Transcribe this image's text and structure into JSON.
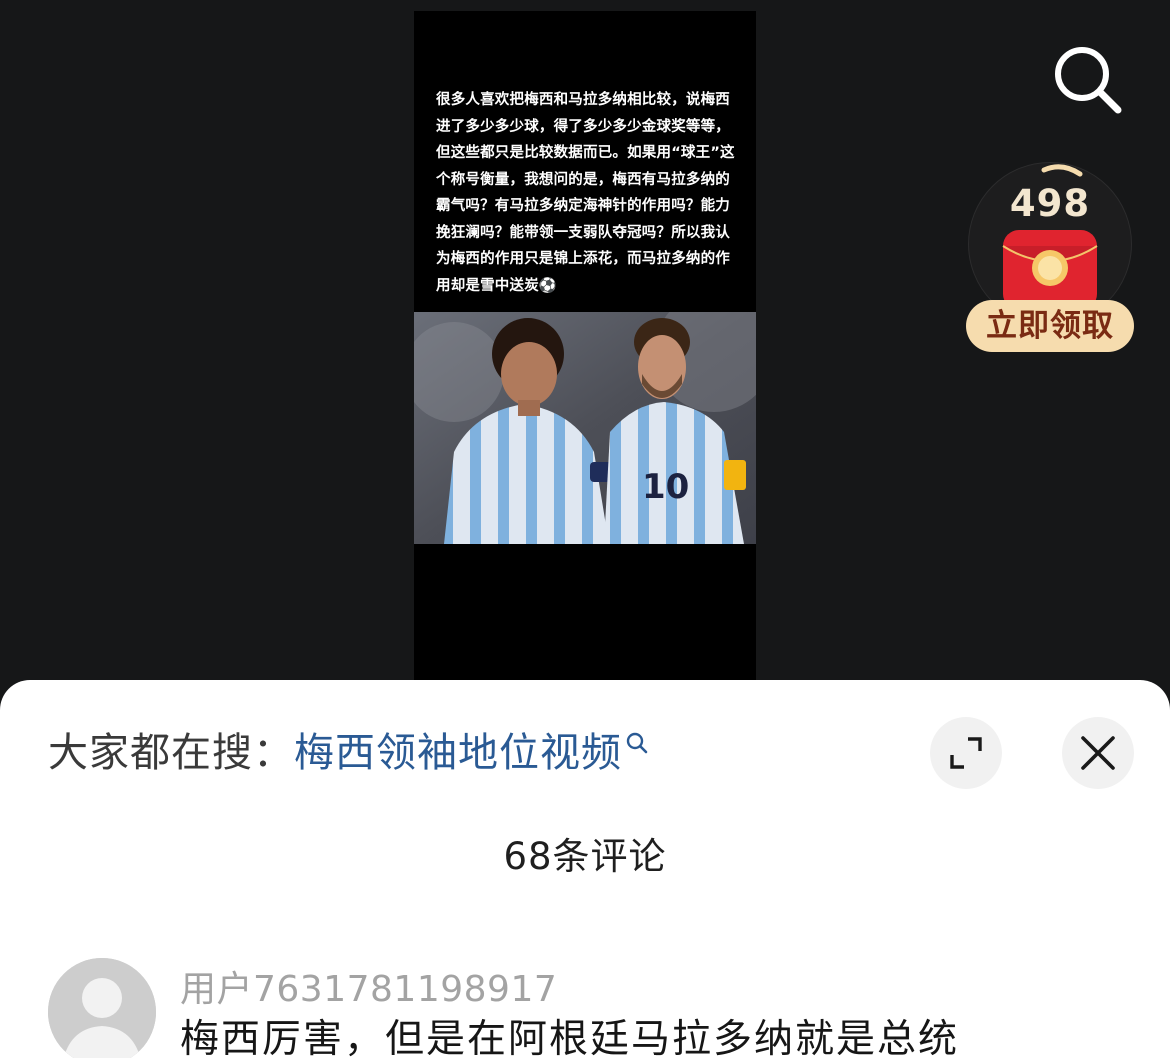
{
  "video": {
    "caption": "很多人喜欢把梅西和马拉多纳相比较，说梅西进了多少多少球，得了多少多少金球奖等等，但这些都只是比较数据而已。如果用“球王”这个称号衡量，我想问的是，梅西有马拉多纳的霸气吗？有马拉多纳定海神针的作用吗？能力挽狂澜吗？能带领一支弱队夺冠吗？所以我认为梅西的作用只是锦上添花，而马拉多纳的作用却是雪中送炭⚽",
    "photo_jersey_number": "10"
  },
  "top_right": {
    "search_icon": "search-icon",
    "reward": {
      "count": "498",
      "label": "立即领取",
      "icon": "red-envelope-icon"
    }
  },
  "sheet": {
    "trending_prefix": "大家都在搜：",
    "trending_query": "梅西领袖地位视频",
    "trending_icon": "search-small-icon",
    "expand_icon": "expand-icon",
    "close_icon": "close-icon",
    "comment_count": "68条评论",
    "comments": [
      {
        "username": "用户7631781198917",
        "text": "梅西厉害，但是在阿根廷马拉多纳就是总统"
      }
    ]
  },
  "colors": {
    "background": "#161718",
    "sheet_background": "#ffffff",
    "link": "#2a5a94",
    "reward_label_bg": "#f6dcae",
    "reward_label_text": "#7a2b13",
    "envelope_red": "#e0242f"
  }
}
